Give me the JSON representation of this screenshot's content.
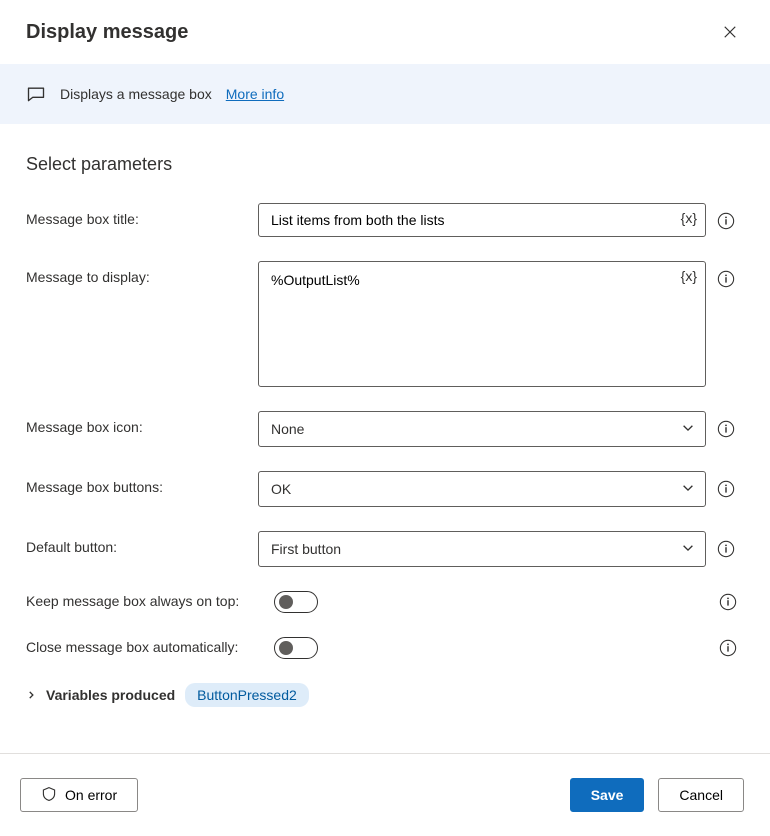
{
  "header": {
    "title": "Display message"
  },
  "banner": {
    "text": "Displays a message box",
    "more_info": "More info"
  },
  "section_title": "Select parameters",
  "fields": {
    "title": {
      "label": "Message box title:",
      "value": "List items from both the lists"
    },
    "message": {
      "label": "Message to display:",
      "value": "%OutputList%"
    },
    "icon": {
      "label": "Message box icon:",
      "value": "None"
    },
    "buttons": {
      "label": "Message box buttons:",
      "value": "OK"
    },
    "default_button": {
      "label": "Default button:",
      "value": "First button"
    },
    "always_on_top": {
      "label": "Keep message box always on top:",
      "value": false
    },
    "auto_close": {
      "label": "Close message box automatically:",
      "value": false
    }
  },
  "variables": {
    "label": "Variables produced",
    "pill": "ButtonPressed2"
  },
  "footer": {
    "on_error": "On error",
    "save": "Save",
    "cancel": "Cancel"
  },
  "tokens": {
    "var_brace": "{x}"
  }
}
